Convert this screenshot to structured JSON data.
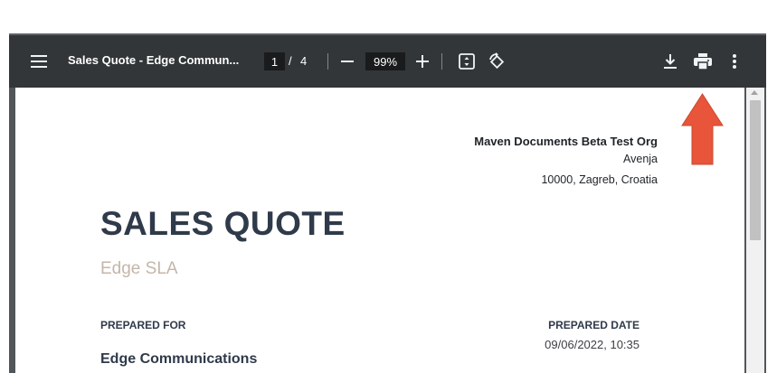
{
  "toolbar": {
    "title": "Sales Quote - Edge Commun...",
    "page_current": "1",
    "page_separator": "/",
    "page_total": "4",
    "zoom": "99%"
  },
  "icons": {
    "menu": "menu-icon",
    "zoom_out": "minus-icon",
    "zoom_in": "plus-icon",
    "fit": "fit-to-page-icon",
    "rotate": "rotate-icon",
    "download": "download-icon",
    "print": "print-icon",
    "more": "more-vertical-icon"
  },
  "document": {
    "org_name": "Maven Documents Beta Test Org",
    "org_address1": "Avenja",
    "org_address2": "10000, Zagreb, Croatia",
    "title": "SALES QUOTE",
    "subtitle": "Edge SLA",
    "prepared_for_label": "PREPARED FOR",
    "prepared_date_label": "PREPARED DATE",
    "prepared_date": "09/06/2022, 10:35",
    "customer": "Edge Communications"
  },
  "colors": {
    "toolbar_bg": "#323639",
    "annotation_arrow": "#e8553a",
    "title_color": "#2f3a4a",
    "subtitle_color": "#c5b6a8"
  }
}
